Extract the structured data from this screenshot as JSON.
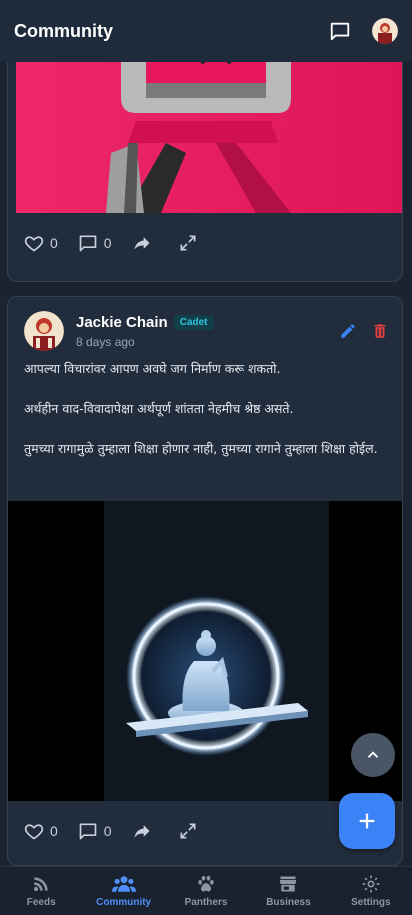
{
  "header": {
    "title": "Community"
  },
  "post1": {
    "likes": "0",
    "comments": "0"
  },
  "post2": {
    "author": "Jackie Chain",
    "badge": "Cadet",
    "time": "8 days ago",
    "paragraphs": [
      "आपल्या विचारांवर आपण अवघे जग निर्माण करू शकतो.",
      "अर्थहीन वाद-विवादापेक्षा अर्थपूर्ण शांतता नेहमीच श्रेष्ठ असते.",
      "तुमच्या रागामुळे तुम्हाला शिक्षा होणार नाही, तुमच्या रागाने तुम्हाला शिक्षा होईल."
    ],
    "likes": "0",
    "comments": "0"
  },
  "nav": {
    "items": [
      {
        "label": "Feeds",
        "icon": "rss-icon"
      },
      {
        "label": "Community",
        "icon": "people-icon"
      },
      {
        "label": "Panthers",
        "icon": "paw-icon"
      },
      {
        "label": "Business",
        "icon": "store-icon"
      },
      {
        "label": "Settings",
        "icon": "gear-icon"
      }
    ],
    "active": "Community"
  },
  "colors": {
    "accent": "#3b82f6",
    "active_nav": "#4f8ff7",
    "badge_text": "#2fc4d8",
    "delete": "#e53e3e",
    "edit": "#3b82f6"
  }
}
